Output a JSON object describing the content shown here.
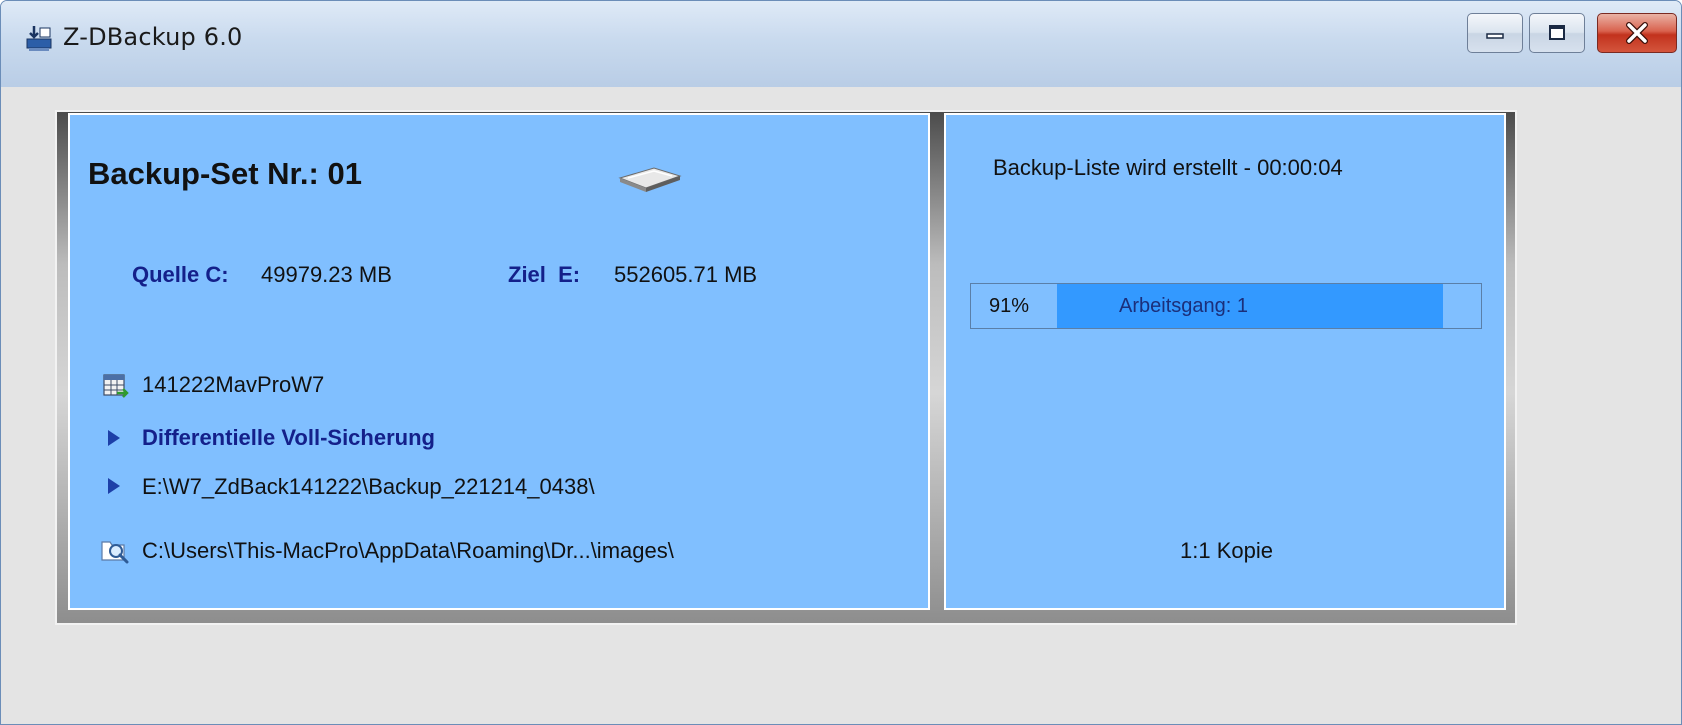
{
  "window": {
    "title": "Z-DBackup 6.0",
    "buttons": {
      "minimize": "minimize",
      "maximize": "maximize",
      "close": "close"
    }
  },
  "left_panel": {
    "set_title": "Backup-Set Nr.: 01",
    "drive_icon": "hard-drive-icon",
    "source_label": "Quelle C:",
    "source_value": "49979.23 MB",
    "target_label": "Ziel  E:",
    "target_value": "552605.71 MB",
    "profile_icon": "table-icon",
    "profile_name": "141222MavProW7",
    "mode_text": "Differentielle Voll-Sicherung",
    "destination_path": "E:\\W7_ZdBack141222\\Backup_221214_0438\\",
    "scan_icon": "search-folder-icon",
    "current_path": "C:\\Users\\This-MacPro\\AppData\\Roaming\\Dr...\\images\\"
  },
  "right_panel": {
    "status": "Backup-Liste wird erstellt - 00:00:04",
    "progress_percent_text": "91%",
    "progress_value": 0.91,
    "progress_label": "Arbeitsgang: 1",
    "copy_mode": "1:1 Kopie"
  },
  "colors": {
    "panel_bg": "#80bfff",
    "progress_fill": "#3399ff",
    "label_blue": "#14208a"
  }
}
